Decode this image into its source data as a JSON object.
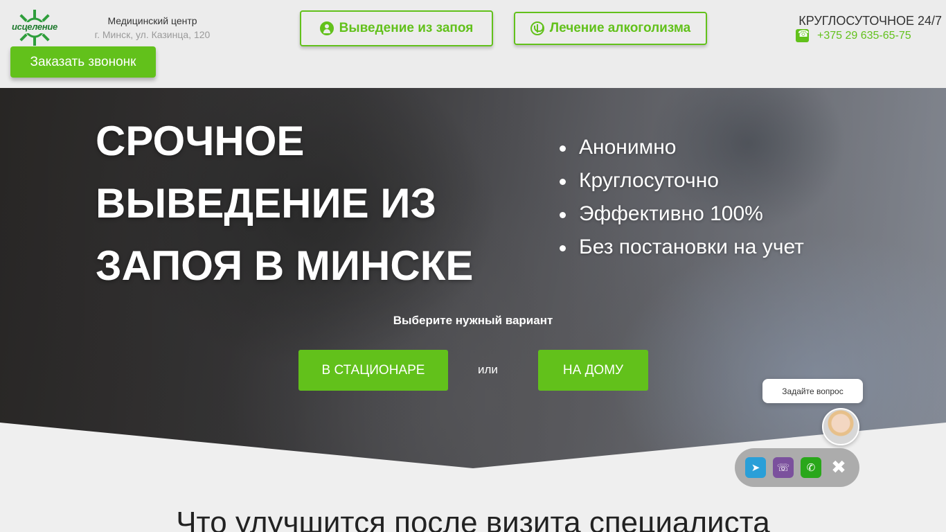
{
  "header": {
    "logo_text": "исцеление",
    "center_name": "Медицинский центр",
    "center_address": "г. Минск, ул. Казинца, 120",
    "callback_button": "Заказать звононк",
    "nav_buttons": [
      {
        "label": "Выведение из запоя",
        "icon": "person-icon"
      },
      {
        "label": "Лечение алкоголизма",
        "icon": "medical-icon"
      }
    ],
    "hours": "КРУГЛОСУТОЧНОЕ 24/7",
    "phone": "+375 29 635-65-75",
    "accent_color": "#62c11b"
  },
  "hero": {
    "title_lines": [
      "СРОЧНОЕ",
      "ВЫВЕДЕНИЕ ИЗ",
      "ЗАПОЯ В МИНСКЕ"
    ],
    "bullets": [
      "Анонимно",
      "Круглосуточно",
      "Эффективно 100%",
      "Без постановки на учет"
    ],
    "choose_label": "Выберите нужный вариант",
    "option_hospital": "В СТАЦИОНАРЕ",
    "or_label": "или",
    "option_home": "НА ДОМУ"
  },
  "section": {
    "title": "Что улучшится после визита специалиста"
  },
  "chat": {
    "prompt": "Задайте вопрос",
    "messengers": [
      "telegram-icon",
      "viber-icon",
      "whatsapp-icon",
      "close-icon"
    ]
  }
}
